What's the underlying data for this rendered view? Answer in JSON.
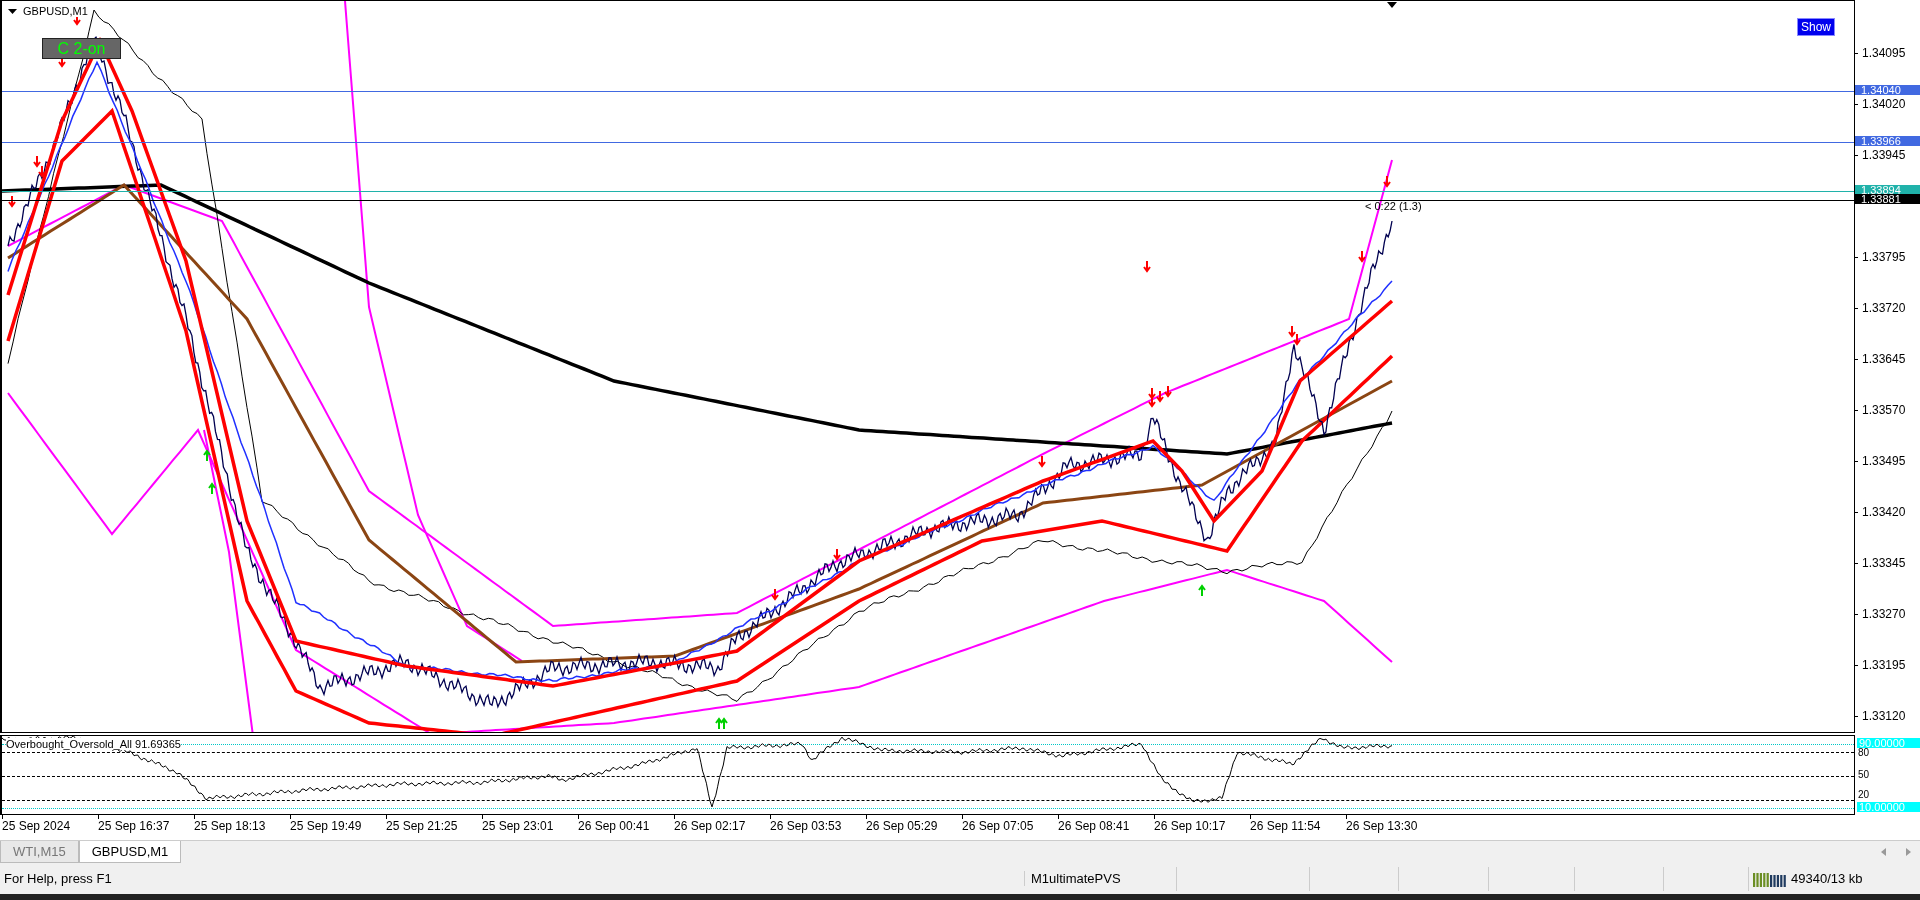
{
  "chart": {
    "title": "GBPUSD,M1",
    "toggle_button": "C 2-on",
    "show_button": "Show",
    "countdown": "< 0:22 (1.3)",
    "price_ticks": [
      "1.34095",
      "1.34020",
      "1.33945",
      "1.33795",
      "1.33720",
      "1.33645",
      "1.33570",
      "1.33495",
      "1.33420",
      "1.33345",
      "1.33270",
      "1.33195",
      "1.33120"
    ],
    "price_lines": [
      {
        "label": "1.34040",
        "kind": "level"
      },
      {
        "label": "1.33966",
        "kind": "level"
      },
      {
        "label": "1.33894",
        "kind": "ask"
      },
      {
        "label": "1.33881",
        "kind": "bid"
      }
    ]
  },
  "indicator": {
    "title": "Overbought_Oversold_All 91.69365",
    "levels": [
      {
        "label": "90.00000",
        "kind": "band"
      },
      {
        "label": "80",
        "kind": "level"
      },
      {
        "label": "50",
        "kind": "level"
      },
      {
        "label": "20",
        "kind": "level"
      },
      {
        "label": "10.00000",
        "kind": "band"
      }
    ]
  },
  "time_axis": [
    "25 Sep 2024",
    "25 Sep 16:37",
    "25 Sep 18:13",
    "25 Sep 19:49",
    "25 Sep 21:25",
    "25 Sep 23:01",
    "26 Sep 00:41",
    "26 Sep 02:17",
    "26 Sep 03:53",
    "26 Sep 05:29",
    "26 Sep 07:05",
    "26 Sep 08:41",
    "26 Sep 10:17",
    "26 Sep 11:54",
    "26 Sep 13:30"
  ],
  "tabs": [
    {
      "label": "WTI,M15",
      "selected": false
    },
    {
      "label": "GBPUSD,M1",
      "selected": true
    }
  ],
  "status_bar": {
    "help": "For Help, press F1",
    "profile": "M1ultimatePVS",
    "traffic": "49340/13 kb"
  }
}
